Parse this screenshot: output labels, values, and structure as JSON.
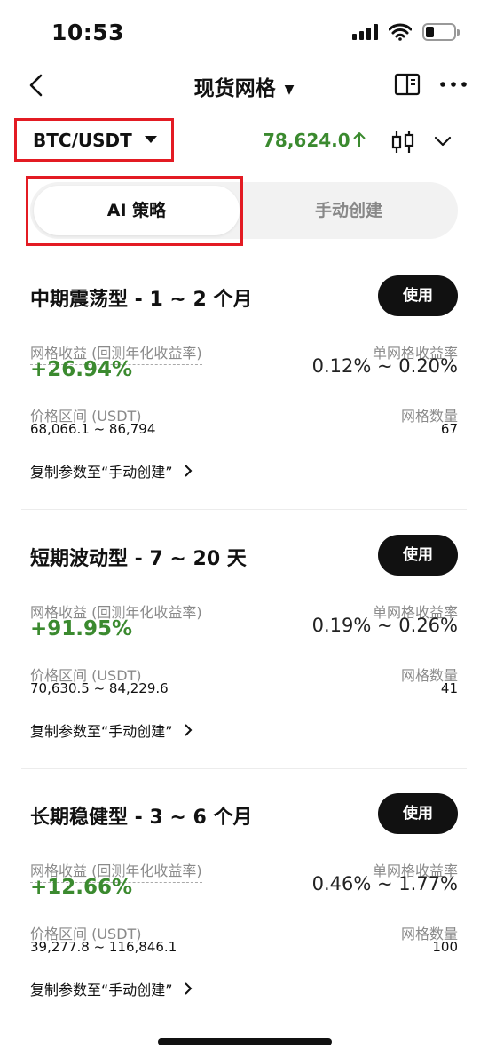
{
  "status_bar": {
    "time": "10:53"
  },
  "nav": {
    "title": "现货网格"
  },
  "pair": {
    "symbol": "BTC/USDT",
    "price": "78,624.0"
  },
  "tabs": {
    "active": "AI 策略",
    "inactive": "手动创建"
  },
  "strategies": [
    {
      "title": "中期震荡型 - 1 ~ 2 个月",
      "use_label": "使用",
      "yield_label": "网格收益 (回测年化收益率)",
      "yield_value": "+26.94%",
      "per_grid_label": "单网格收益率",
      "per_grid_value": "0.12% ~ 0.20%",
      "range_label": "价格区间 (USDT)",
      "range_value": "68,066.1 ~ 86,794",
      "grid_count_label": "网格数量",
      "grid_count_value": "67",
      "copy_label": "复制参数至“手动创建”"
    },
    {
      "title": "短期波动型 - 7 ~ 20 天",
      "use_label": "使用",
      "yield_label": "网格收益 (回测年化收益率)",
      "yield_value": "+91.95%",
      "per_grid_label": "单网格收益率",
      "per_grid_value": "0.19% ~ 0.26%",
      "range_label": "价格区间 (USDT)",
      "range_value": "70,630.5 ~ 84,229.6",
      "grid_count_label": "网格数量",
      "grid_count_value": "41",
      "copy_label": "复制参数至“手动创建”"
    },
    {
      "title": "长期稳健型 - 3 ~ 6 个月",
      "use_label": "使用",
      "yield_label": "网格收益 (回测年化收益率)",
      "yield_value": "+12.66%",
      "per_grid_label": "单网格收益率",
      "per_grid_value": "0.46% ~ 1.77%",
      "range_label": "价格区间 (USDT)",
      "range_value": "39,277.8 ~ 116,846.1",
      "grid_count_label": "网格数量",
      "grid_count_value": "100",
      "copy_label": "复制参数至“手动创建”"
    }
  ],
  "colors": {
    "positive": "#3b8a2f",
    "highlight_border": "#e31b23",
    "button_bg": "#111111"
  },
  "icons": [
    "signal-icon",
    "wifi-icon",
    "battery-icon",
    "back-arrow-icon",
    "dropdown-caret-icon",
    "book-icon",
    "more-icon",
    "price-up-arrow-icon",
    "candlestick-icon",
    "chevron-down-icon",
    "chevron-right-icon"
  ]
}
